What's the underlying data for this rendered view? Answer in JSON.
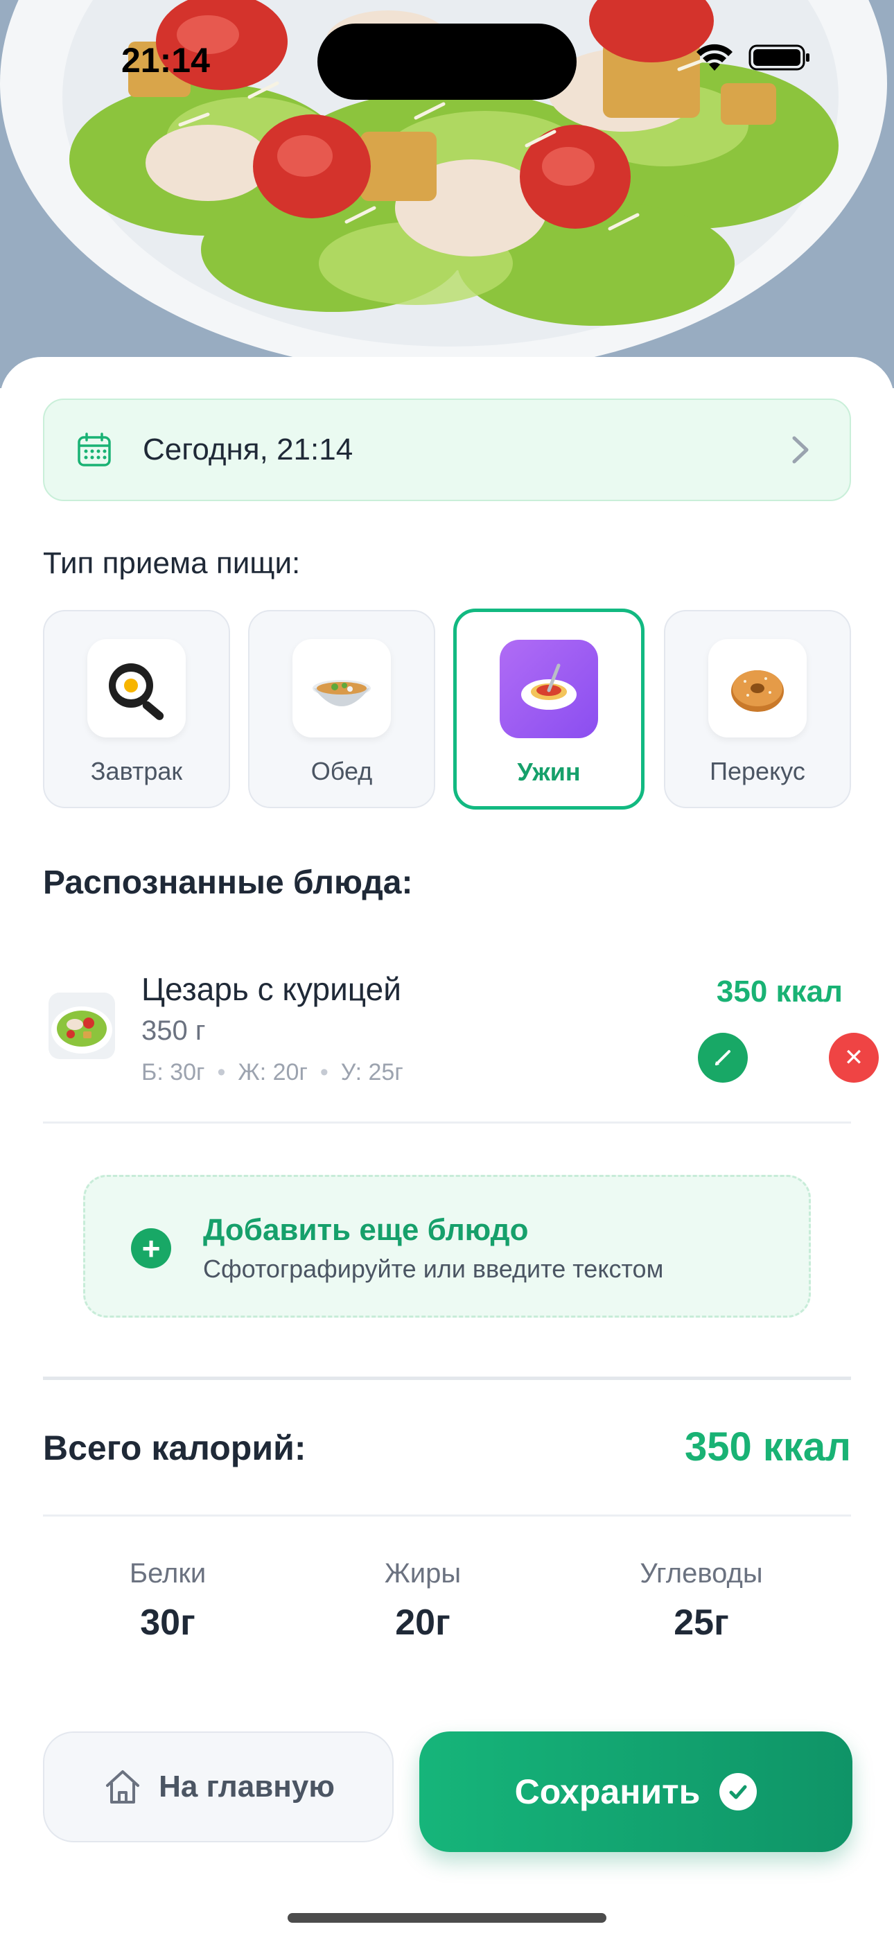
{
  "status_bar": {
    "time": "21:14"
  },
  "date_selector": {
    "text": "Сегодня, 21:14"
  },
  "meal_type": {
    "title": "Тип приема пищи:",
    "options": [
      {
        "label": "Завтрак",
        "icon": "frying-pan-egg-icon",
        "selected": false
      },
      {
        "label": "Обед",
        "icon": "soup-bowl-icon",
        "selected": false
      },
      {
        "label": "Ужин",
        "icon": "spaghetti-icon",
        "selected": true
      },
      {
        "label": "Перекус",
        "icon": "bagel-icon",
        "selected": false
      }
    ]
  },
  "recognized": {
    "title": "Распознанные блюда:",
    "dishes": [
      {
        "name": "Цезарь с курицей",
        "weight": "350 г",
        "protein": "Б: 30г",
        "fat": "Ж: 20г",
        "carbs": "У: 25г",
        "kcal": "350 ккал"
      }
    ]
  },
  "add_dish": {
    "title": "Добавить еще блюдо",
    "subtitle": "Сфотографируйте или введите текстом"
  },
  "totals": {
    "label": "Всего калорий:",
    "value": "350 ккал",
    "macros": [
      {
        "label": "Белки",
        "value": "30г"
      },
      {
        "label": "Жиры",
        "value": "20г"
      },
      {
        "label": "Углеводы",
        "value": "25г"
      }
    ]
  },
  "actions": {
    "home_label": "На главную",
    "save_label": "Сохранить"
  },
  "colors": {
    "accent": "#19b274",
    "danger": "#ef4444",
    "selected_icon_bg": "#9b5cf3"
  }
}
